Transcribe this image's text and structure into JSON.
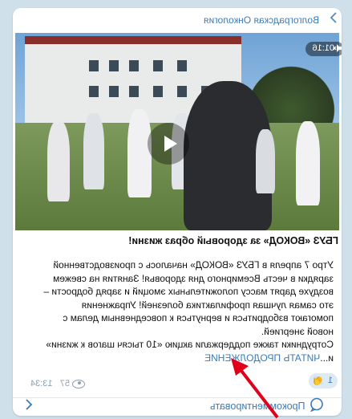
{
  "channel": {
    "name": "Волгоградская Онкология"
  },
  "video": {
    "duration": "01:16"
  },
  "post": {
    "title": "ГБУЗ «ВОКОД» за здоровый образ жизни!",
    "lines": [
      "Утро 7 апреля в ГБУЗ «ВОКОД» началось с производственной",
      "зарядки в честь Всемирного дня здоровья! Занятия на свежем",
      "воздухе дарят массу положительных эмоций и заряд бодрости –",
      "это самая лучшая профилактика болезней! Упражнения",
      "помогают взбодриться и вернуться к повседневным делам с",
      "новой энергией.",
      "Сотрудники также поддержали акцию «10 тысяч шагов к жизни»",
      "и..."
    ],
    "read_more": "ЧИТАТЬ ПРОДОЛЖЕНИЕ"
  },
  "reaction": {
    "count": "1",
    "emoji": "👏"
  },
  "meta": {
    "views": "57",
    "time": "13:34"
  },
  "footer": {
    "comment_label": "Прокомментировать"
  },
  "colors": {
    "accent": "#3a7bb8",
    "background": "#cfe0ea",
    "annotation": "#e0001b"
  }
}
